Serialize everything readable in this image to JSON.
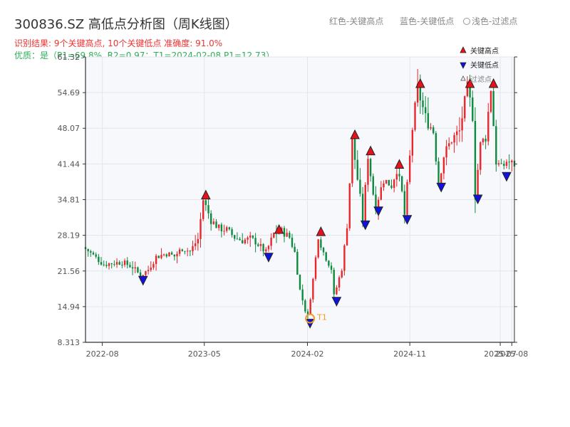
{
  "header": {
    "title": "300836.SZ 高低点分析图（周K线图）",
    "result_line": "识别结果: 9个关键高点, 10个关键低点  准确度: 91.0%",
    "quality_line": "优质：是（P1=69.8%, R2=0.97；T1=2024-02-08 P1=12.73）",
    "legend_high": "红色-关键高点",
    "legend_low": "蓝色-关键低点",
    "legend_filtered": "浅色-过滤点"
  },
  "colors": {
    "up": "#e8262b",
    "down": "#0e8a3f",
    "high_marker": "#e8101a",
    "low_marker": "#1212dd",
    "t1_marker": "#f59a23",
    "plot_bg": "#f6f8fb",
    "grid": "#e2e6ec"
  },
  "chart_data": {
    "type": "candlestick",
    "x_range": [
      "2022-06-17",
      "2025-08-08"
    ],
    "y_range": [
      8.313,
      61.32
    ],
    "y_ticks": [
      8.313,
      14.94,
      21.56,
      28.19,
      34.81,
      41.44,
      48.07,
      54.69,
      61.32
    ],
    "y_tick_labels": [
      "8.313",
      "14.94",
      "21.56",
      "28.19",
      "34.81",
      "41.44",
      "48.07",
      "54.69",
      "61.32"
    ],
    "x_ticks": [
      "2022-08",
      "2023-05",
      "2024-02",
      "2024-11",
      "2025-07",
      "2025-08"
    ],
    "x_tick_dates": [
      "2022-08-01",
      "2023-05-01",
      "2024-02-01",
      "2024-11-01",
      "2025-07-01",
      "2025-08-01"
    ],
    "price_path": [
      [
        "2022-06-17",
        26.0
      ],
      [
        "2022-07-01",
        25.3
      ],
      [
        "2022-07-22",
        24.0
      ],
      [
        "2022-08-12",
        22.8
      ],
      [
        "2022-09-02",
        23.0
      ],
      [
        "2022-09-30",
        23.2
      ],
      [
        "2022-10-28",
        22.3
      ],
      [
        "2022-11-18",
        20.7
      ],
      [
        "2022-12-09",
        21.8
      ],
      [
        "2022-12-30",
        24.2
      ],
      [
        "2023-01-27",
        24.8
      ],
      [
        "2023-02-17",
        24.3
      ],
      [
        "2023-03-10",
        25.8
      ],
      [
        "2023-03-31",
        25.2
      ],
      [
        "2023-04-21",
        27.5
      ],
      [
        "2023-05-05",
        34.8
      ],
      [
        "2023-05-26",
        31.0
      ],
      [
        "2023-06-16",
        29.5
      ],
      [
        "2023-07-07",
        29.2
      ],
      [
        "2023-07-28",
        27.8
      ],
      [
        "2023-08-18",
        27.2
      ],
      [
        "2023-09-08",
        27.6
      ],
      [
        "2023-09-22",
        27.0
      ],
      [
        "2023-10-20",
        25.0
      ],
      [
        "2023-11-10",
        28.5
      ],
      [
        "2023-12-01",
        29.0
      ],
      [
        "2023-12-22",
        27.8
      ],
      [
        "2024-01-05",
        25.0
      ],
      [
        "2024-01-19",
        18.0
      ],
      [
        "2024-02-08",
        12.73
      ],
      [
        "2024-02-23",
        20.0
      ],
      [
        "2024-03-08",
        28.0
      ],
      [
        "2024-03-22",
        25.0
      ],
      [
        "2024-04-12",
        22.0
      ],
      [
        "2024-04-19",
        16.8
      ],
      [
        "2024-05-10",
        22.0
      ],
      [
        "2024-05-24",
        30.0
      ],
      [
        "2024-06-07",
        46.0
      ],
      [
        "2024-06-28",
        35.0
      ],
      [
        "2024-07-05",
        31.0
      ],
      [
        "2024-07-19",
        43.0
      ],
      [
        "2024-08-02",
        36.0
      ],
      [
        "2024-08-09",
        33.6
      ],
      [
        "2024-08-30",
        38.5
      ],
      [
        "2024-09-20",
        37.5
      ],
      [
        "2024-10-04",
        40.5
      ],
      [
        "2024-10-18",
        36.0
      ],
      [
        "2024-10-25",
        32.0
      ],
      [
        "2024-11-15",
        48.0
      ],
      [
        "2024-11-29",
        55.5
      ],
      [
        "2024-12-20",
        50.0
      ],
      [
        "2025-01-10",
        47.5
      ],
      [
        "2025-01-24",
        38.0
      ],
      [
        "2025-02-07",
        43.0
      ],
      [
        "2025-02-28",
        46.0
      ],
      [
        "2025-03-21",
        47.5
      ],
      [
        "2025-04-11",
        55.5
      ],
      [
        "2025-04-25",
        50.5
      ],
      [
        "2025-05-02",
        35.8
      ],
      [
        "2025-05-16",
        45.0
      ],
      [
        "2025-05-30",
        46.5
      ],
      [
        "2025-06-13",
        55.5
      ],
      [
        "2025-06-27",
        42.0
      ],
      [
        "2025-07-11",
        40.5
      ],
      [
        "2025-07-25",
        42.0
      ],
      [
        "2025-08-08",
        41.44
      ]
    ],
    "key_highs": [
      {
        "date": "2023-05-05",
        "price": 34.8
      },
      {
        "date": "2023-11-17",
        "price": 28.4
      },
      {
        "date": "2024-03-08",
        "price": 28.0
      },
      {
        "date": "2024-06-07",
        "price": 46.0
      },
      {
        "date": "2024-07-19",
        "price": 43.0
      },
      {
        "date": "2024-10-04",
        "price": 40.5
      },
      {
        "date": "2024-11-29",
        "price": 55.5
      },
      {
        "date": "2025-04-11",
        "price": 55.5
      },
      {
        "date": "2025-06-13",
        "price": 55.5
      }
    ],
    "key_lows": [
      {
        "date": "2022-11-18",
        "price": 20.7
      },
      {
        "date": "2023-10-20",
        "price": 25.0
      },
      {
        "date": "2024-02-08",
        "price": 12.73
      },
      {
        "date": "2024-04-19",
        "price": 16.8
      },
      {
        "date": "2024-07-05",
        "price": 31.0
      },
      {
        "date": "2024-08-09",
        "price": 33.6
      },
      {
        "date": "2024-10-25",
        "price": 32.0
      },
      {
        "date": "2025-01-24",
        "price": 38.0
      },
      {
        "date": "2025-05-02",
        "price": 35.8
      },
      {
        "date": "2025-07-18",
        "price": 40.0
      }
    ],
    "t1": {
      "date": "2024-02-08",
      "price": 12.73,
      "label": "T1"
    },
    "legend": {
      "position": "top-right",
      "high_label": "关键高点",
      "low_label": "关键低点",
      "filtered_label": "过滤点"
    },
    "grid": true
  }
}
